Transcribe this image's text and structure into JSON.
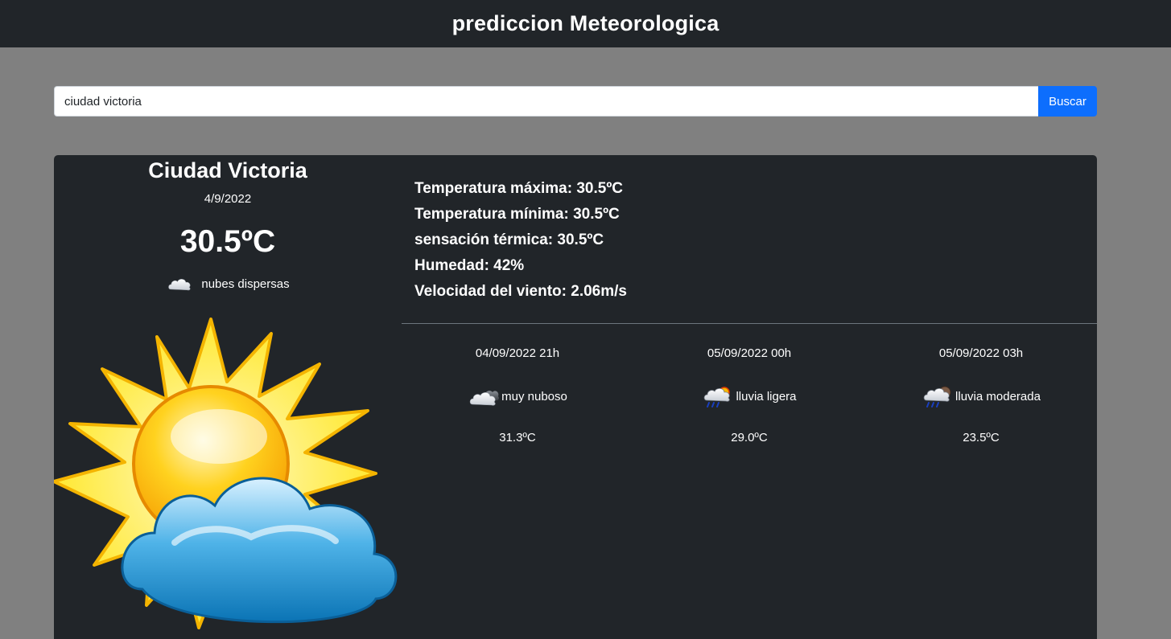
{
  "header": {
    "title": "prediccion Meteorologica"
  },
  "search": {
    "value": "ciudad victoria",
    "placeholder": "",
    "button_label": "Buscar"
  },
  "current": {
    "city": "Ciudad Victoria",
    "date": "4/9/2022",
    "temperature": "30.5ºC",
    "description": "nubes dispersas",
    "icon": "scattered-clouds-icon",
    "big_icon": "sun-behind-cloud-icon"
  },
  "details": [
    {
      "text": "Temperatura máxima: 30.5ºC"
    },
    {
      "text": "Temperatura mínima: 30.5ºC"
    },
    {
      "text": "sensación térmica: 30.5ºC"
    },
    {
      "text": "Humedad: 42%"
    },
    {
      "text": "Velocidad del viento: 2.06m/s"
    }
  ],
  "forecast": [
    {
      "datetime": "04/09/2022 21h",
      "description": "muy nuboso",
      "temperature": "31.3ºC",
      "icon": "broken-clouds-icon"
    },
    {
      "datetime": "05/09/2022 00h",
      "description": "lluvia ligera",
      "temperature": "29.0ºC",
      "icon": "light-rain-icon"
    },
    {
      "datetime": "05/09/2022 03h",
      "description": "lluvia moderada",
      "temperature": "23.5ºC",
      "icon": "moderate-rain-icon"
    }
  ],
  "colors": {
    "navbar": "#212529",
    "page_bg": "#808080",
    "card_bg": "#212529",
    "button": "#0d6efd"
  }
}
